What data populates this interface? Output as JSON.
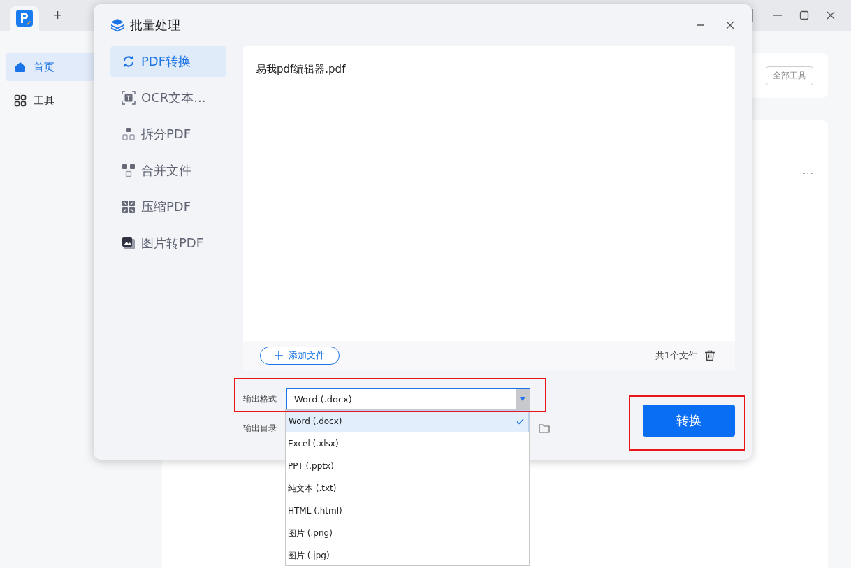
{
  "app": {
    "new_tab": "+",
    "sidebar": [
      {
        "label": "首页",
        "kind": "home",
        "selected": true
      },
      {
        "label": "工具",
        "kind": "grid",
        "selected": false
      }
    ],
    "tools_button": "全部工具",
    "more": "···"
  },
  "dialog": {
    "title": "批量处理",
    "nav": [
      {
        "label": "PDF转换",
        "kind": "convert",
        "selected": true
      },
      {
        "label": "OCR文本...",
        "kind": "ocr",
        "selected": false
      },
      {
        "label": "拆分PDF",
        "kind": "split",
        "selected": false
      },
      {
        "label": "合并文件",
        "kind": "merge",
        "selected": false
      },
      {
        "label": "压缩PDF",
        "kind": "compress",
        "selected": false
      },
      {
        "label": "图片转PDF",
        "kind": "image",
        "selected": false
      }
    ],
    "files": [
      "易我pdf编辑器.pdf"
    ],
    "add_button": "添加文件",
    "file_count": "共1个文件",
    "format_label": "输出格式",
    "format_value": "Word (.docx)",
    "dir_label": "输出目录",
    "options": [
      {
        "label": "Word (.docx)",
        "selected": true
      },
      {
        "label": "Excel (.xlsx)",
        "selected": false
      },
      {
        "label": "PPT (.pptx)",
        "selected": false
      },
      {
        "label": "纯文本 (.txt)",
        "selected": false
      },
      {
        "label": "HTML (.html)",
        "selected": false
      },
      {
        "label": "图片 (.png)",
        "selected": false
      },
      {
        "label": "图片 (.jpg)",
        "selected": false
      }
    ],
    "convert_button": "转换"
  }
}
